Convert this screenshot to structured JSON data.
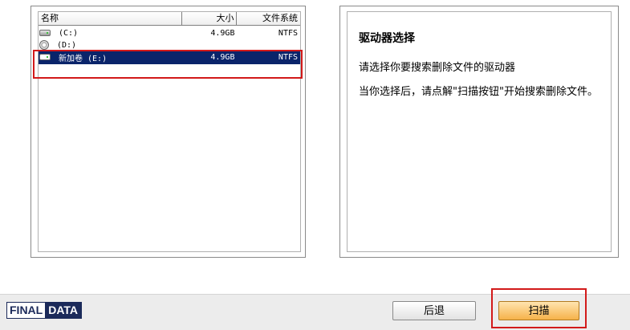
{
  "drive_list": {
    "columns": {
      "name": "名称",
      "size": "大小",
      "filesystem": "文件系统"
    },
    "rows": [
      {
        "name": "(C:)",
        "size": "4.9GB",
        "filesystem": "NTFS",
        "icon": "hard-drive-icon"
      },
      {
        "name": "(D:)",
        "size": "",
        "filesystem": "",
        "icon": "cd-drive-icon"
      },
      {
        "name": "新加卷 (E:)",
        "size": "4.9GB",
        "filesystem": "NTFS",
        "icon": "hard-drive-icon",
        "selected": true
      }
    ]
  },
  "info": {
    "title": "驱动器选择",
    "line1": "请选择你要搜索删除文件的驱动器",
    "line2": "当你选择后，请点解\"扫描按钮\"开始搜索删除文件。"
  },
  "footer": {
    "logo_part1": "FINAL",
    "logo_part2": "DATA",
    "back_label": "后退",
    "scan_label": "扫描"
  },
  "colors": {
    "selection": "#0a246a",
    "highlight_box": "#d21a1a",
    "scan_button": "#f6b24a"
  }
}
